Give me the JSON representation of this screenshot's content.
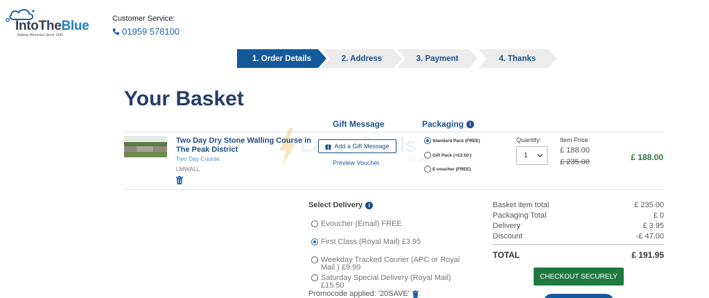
{
  "header": {
    "logo_part1": "IntoThe",
    "logo_part2": "Blue",
    "logo_tagline": "Making Memories Since 1996",
    "cs_label": "Customer Service:",
    "cs_phone": "01959 578100"
  },
  "steps": [
    {
      "label": "1.  Order Details",
      "active": true
    },
    {
      "label": "2.  Address",
      "active": false
    },
    {
      "label": "3.  Payment",
      "active": false
    },
    {
      "label": "4.  Thanks",
      "active": false
    }
  ],
  "page_title": "Your Basket",
  "columns": {
    "gift_message": "Gift Message",
    "packaging": "Packaging"
  },
  "item": {
    "title": "Two Day Dry Stone Walling Course in The Peak District",
    "subtitle": "Two Day Course",
    "sku": "LMWALL",
    "gift_button": "Add a Gift Message",
    "preview_link": "Preview Voucher",
    "packaging_options": [
      {
        "label": "Standard Pack (FREE)",
        "selected": true
      },
      {
        "label": "Gift Pack (+£3.50 )",
        "selected": false
      },
      {
        "label": "E-voucher (FREE)",
        "selected": false
      }
    ],
    "quantity_label": "Quantity:",
    "quantity_value": "1",
    "price_label": "Item Price",
    "price_now": "£ 188.00",
    "price_was": "£ 235.00",
    "line_total": "£ 188.00"
  },
  "watermark": {
    "text": "LatestDeals",
    "suffix": ".co.uk"
  },
  "delivery": {
    "heading": "Select Delivery",
    "options": [
      {
        "label": "Evoucher (Email) FREE",
        "selected": false
      },
      {
        "label": "First Class (Royal Mail) £3.95",
        "selected": true
      },
      {
        "label": "Weekday Tracked Courier (APC or Royal Mail ) £9.99",
        "selected": false
      },
      {
        "label": "Saturday Special Delivery (Royal Mail) £15.50",
        "selected": false
      }
    ],
    "promo_text": "Promocode applied: '20SAVE'"
  },
  "summary": {
    "rows": [
      {
        "label": "Basket item total",
        "value": "£ 235.00"
      },
      {
        "label": "Packaging Total",
        "value": "£ 0"
      },
      {
        "label": "Delivery",
        "value": "£ 3.95"
      },
      {
        "label": "Discount",
        "value": "-£ 47.00"
      }
    ],
    "total_label": "TOTAL",
    "total_value": "£ 191.95",
    "checkout_label": "CHECKOUT SECURELY"
  },
  "colors": {
    "brand_navy": "#233e68",
    "step_active": "#14599c",
    "price_green": "#2a7a3a",
    "checkout_green": "#1f7a40"
  },
  "icons": [
    "cloud-logo-icon",
    "phone-icon",
    "info-icon",
    "gift-icon",
    "trash-icon",
    "chevron-down-icon",
    "lightning-icon"
  ]
}
